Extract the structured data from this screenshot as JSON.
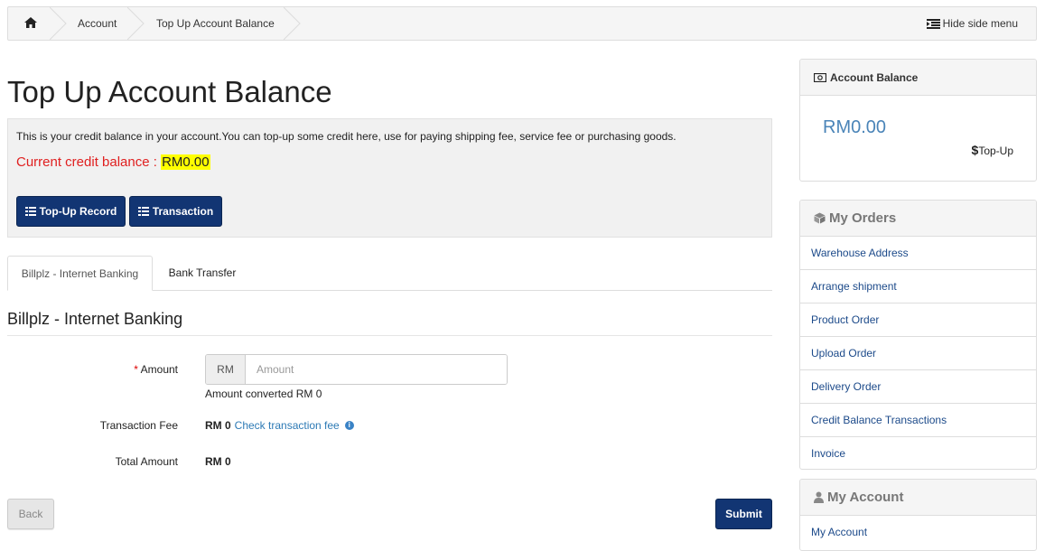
{
  "breadcrumb": {
    "home_icon": "home-icon",
    "items": [
      "Account",
      "Top Up Account Balance"
    ],
    "hide_side_menu": "Hide side menu"
  },
  "page": {
    "title": "Top Up Account Balance",
    "info_text": "This is your credit balance in your account.You can top-up some credit here, use for paying shipping fee, service fee or purchasing goods.",
    "credit_label": "Current credit balance : ",
    "credit_value": "RM0.00",
    "buttons": {
      "topup_record": "Top-Up Record",
      "transaction": "Transaction"
    }
  },
  "tabs": [
    {
      "label": "Billplz - Internet Banking",
      "active": true
    },
    {
      "label": "Bank Transfer",
      "active": false
    }
  ],
  "form": {
    "section_title": "Billplz - Internet Banking",
    "amount_required_mark": "*",
    "amount_label": "Amount",
    "amount_addon": "RM",
    "amount_placeholder": "Amount",
    "amount_value": "",
    "converted_text": "Amount converted RM 0",
    "fee_label": "Transaction Fee",
    "fee_value": "RM 0",
    "fee_link": "Check transaction fee",
    "total_label": "Total Amount",
    "total_value": "RM 0",
    "back_label": "Back",
    "submit_label": "Submit"
  },
  "sidebar": {
    "balance": {
      "title": "Account Balance",
      "amount": "RM0.00",
      "topup_symbol": "$",
      "topup_label": "Top-Up"
    },
    "orders": {
      "title": "My Orders",
      "items": [
        "Warehouse Address",
        "Arrange shipment",
        "Product Order",
        "Upload Order",
        "Delivery Order",
        "Credit Balance Transactions",
        "Invoice"
      ]
    },
    "account": {
      "title": "My Account",
      "items": [
        "My Account"
      ]
    }
  },
  "colors": {
    "navy_button": "#123573",
    "link_blue": "#1c4a8a",
    "balance_blue": "#4a84b8",
    "credit_red": "#e02020",
    "highlight_yellow": "#ffff00"
  }
}
